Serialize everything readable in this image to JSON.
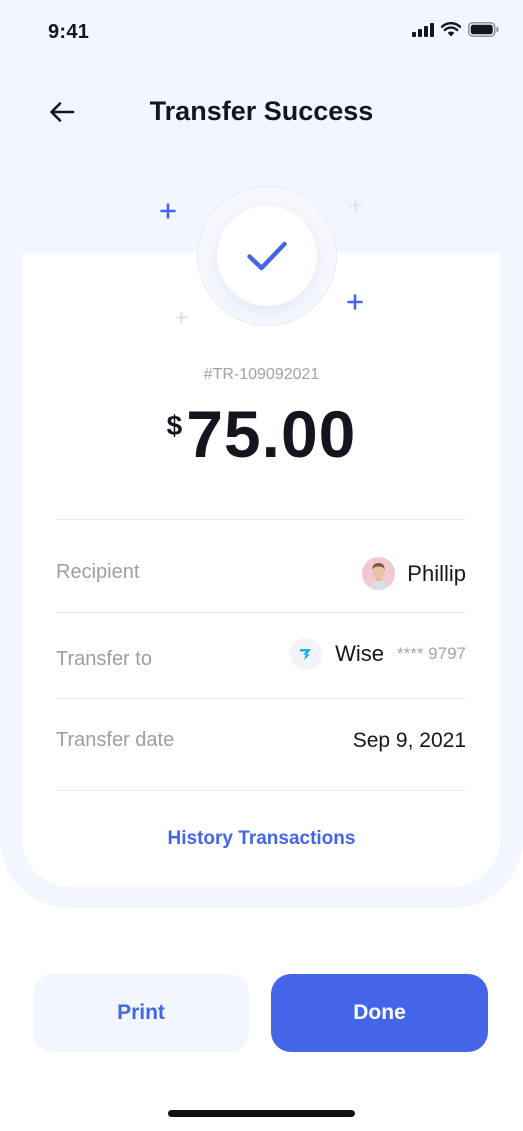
{
  "status_bar": {
    "time": "9:41",
    "icons": [
      "signal-icon",
      "wifi-icon",
      "battery-icon"
    ]
  },
  "header": {
    "back_icon": "arrow-left-icon",
    "title": "Transfer Success"
  },
  "hero": {
    "icon": "checkmark-icon"
  },
  "transaction": {
    "id": "#TR-109092021",
    "currency": "$",
    "amount": "75.00"
  },
  "details": {
    "recipient": {
      "label": "Recipient",
      "name": "Phillip",
      "avatar": "avatar"
    },
    "transfer_to": {
      "label": "Transfer to",
      "provider": "Wise",
      "provider_icon": "wise-logo",
      "masked_account": "**** 9797"
    },
    "transfer_date": {
      "label": "Transfer date",
      "value": "Sep 9, 2021"
    }
  },
  "history_link": "History Transactions",
  "actions": {
    "print": "Print",
    "done": "Done"
  },
  "colors": {
    "accent": "#4365e8",
    "background_tint": "#f2f6ff",
    "text_primary": "#14161f",
    "text_muted": "#9a9eaa"
  }
}
